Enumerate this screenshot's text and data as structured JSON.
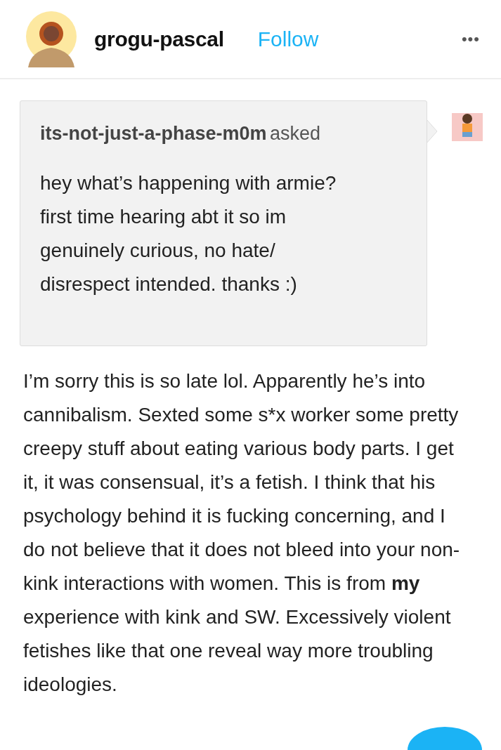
{
  "header": {
    "blog_name": "grogu-pascal",
    "follow_label": "Follow",
    "menu_label": "•••"
  },
  "ask": {
    "asker": "its-not-just-a-phase-m0m",
    "verb": "asked",
    "question": "hey what’s happening with armie? first time hearing abt it so im genuinely curious, no hate/ disrespect intended. thanks :)"
  },
  "answer": {
    "text": "I’m sorry this is so late lol. Apparently he’s into cannibalism. Sexted some s*x worker some pretty creepy stuff about eating various body parts. I get it, it was consensual, it’s a fetish. I think that his psychology behind it is fucking concerning, and I do not believe that it does not bleed into your non-kink interactions with women. This is from **my** experience with kink and SW. Excessively violent fetishes like that one reveal way more troubling ideologies."
  }
}
